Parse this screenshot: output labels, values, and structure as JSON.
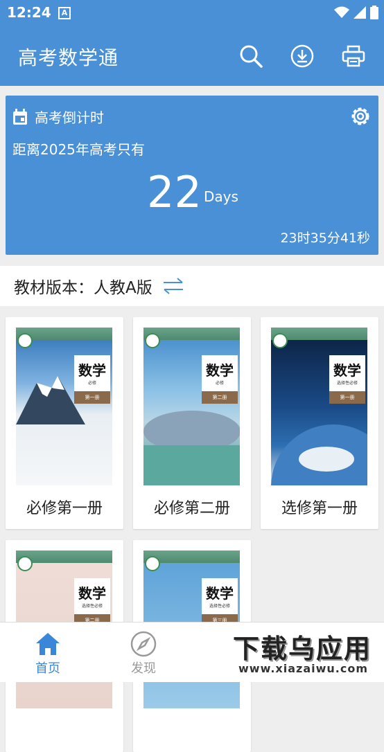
{
  "status_bar": {
    "time": "12:24",
    "notification_glyph": "A"
  },
  "app_bar": {
    "title": "高考数学通",
    "icons": [
      "search-icon",
      "download-icon",
      "print-icon"
    ]
  },
  "countdown": {
    "header": "高考倒计时",
    "subtitle": "距离2025年高考只有",
    "days": "22",
    "unit": "Days",
    "remaining": "23时35分41秒"
  },
  "edition": {
    "label": "教材版本：人教A版"
  },
  "books": [
    {
      "name": "必修第一册",
      "math": "数学",
      "sub": "必修",
      "vol": "第一册"
    },
    {
      "name": "必修第二册",
      "math": "数学",
      "sub": "必修",
      "vol": "第二册"
    },
    {
      "name": "选修第一册",
      "math": "数学",
      "sub": "选择性必修",
      "vol": "第一册"
    },
    {
      "name": "",
      "math": "数学",
      "sub": "选择性必修",
      "vol": "第二册"
    },
    {
      "name": "",
      "math": "数学",
      "sub": "选择性必修",
      "vol": "第三册"
    }
  ],
  "tabs": [
    {
      "label": "首页",
      "active": true
    },
    {
      "label": "发现",
      "active": false
    }
  ],
  "watermark": {
    "text": "下载乌应用",
    "url": "www.xiazaiwu.com"
  },
  "colors": {
    "primary": "#4a90d6",
    "active_tab": "#3a86d8",
    "inactive_tab": "#999999"
  }
}
